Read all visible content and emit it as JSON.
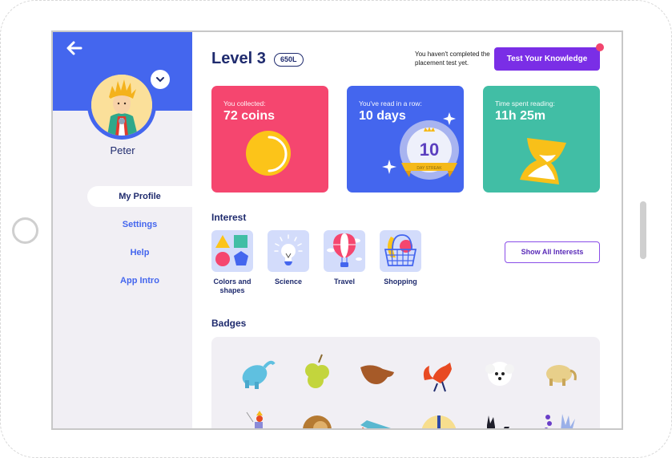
{
  "sidebar": {
    "back_label": "Back",
    "username": "Peter",
    "nav": [
      {
        "label": "My Profile",
        "active": true
      },
      {
        "label": "Settings",
        "active": false
      },
      {
        "label": "Help",
        "active": false
      },
      {
        "label": "App Intro",
        "active": false
      }
    ]
  },
  "header": {
    "level": "Level 3",
    "lexile": "650L",
    "placement_note": "You haven't completed the placement test yet.",
    "test_button": "Test Your Knowledge"
  },
  "stats": [
    {
      "label": "You collected:",
      "value": "72 coins",
      "color": "#f5466f",
      "icon": "coin-icon"
    },
    {
      "label": "You've read in a row:",
      "value": "10 days",
      "color": "#4466ee",
      "icon": "streak-badge-icon",
      "badge_number": "10",
      "badge_ribbon": "DAY STREAK"
    },
    {
      "label": "Time spent reading:",
      "value": "11h 25m",
      "color": "#41bea5",
      "icon": "hourglass-icon"
    }
  ],
  "interest": {
    "title": "Interest",
    "items": [
      {
        "label": "Colors and shapes",
        "icon": "shapes-icon"
      },
      {
        "label": "Science",
        "icon": "lightbulb-icon"
      },
      {
        "label": "Travel",
        "icon": "hot-air-balloon-icon"
      },
      {
        "label": "Shopping",
        "icon": "shopping-basket-icon"
      }
    ],
    "show_all": "Show All Interests"
  },
  "badges": {
    "title": "Badges",
    "items": [
      {
        "name": "blue-elephant-badge"
      },
      {
        "name": "green-grapes-badge"
      },
      {
        "name": "brown-bird-badge"
      },
      {
        "name": "red-fox-badge"
      },
      {
        "name": "white-dog-badge"
      },
      {
        "name": "golden-elephant-badge"
      },
      {
        "name": "knight-badge"
      },
      {
        "name": "lion-badge"
      },
      {
        "name": "blue-boat-badge"
      },
      {
        "name": "planet-badge"
      },
      {
        "name": "black-dog-badge"
      },
      {
        "name": "flowers-badge"
      }
    ]
  },
  "colors": {
    "primary_blue": "#4466ee",
    "navy_text": "#1f2b6e",
    "purple_button": "#7a2ee6",
    "notification_dot": "#f2456e"
  }
}
